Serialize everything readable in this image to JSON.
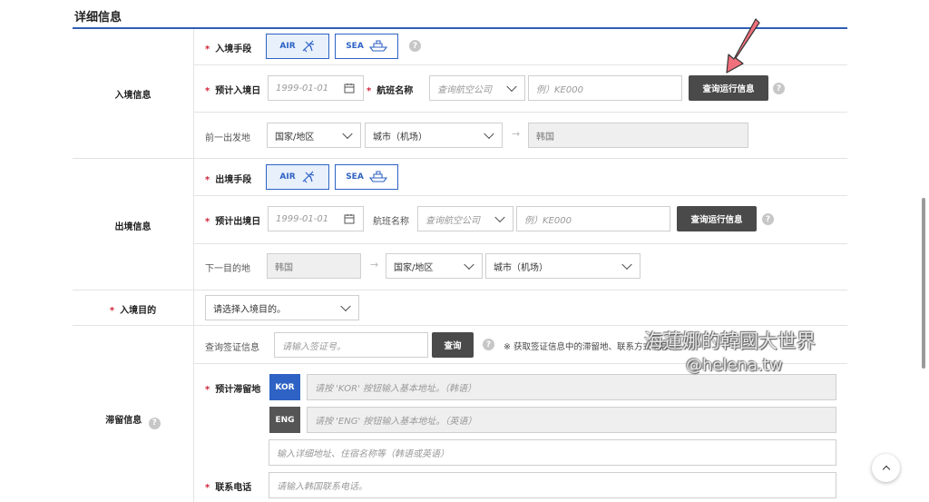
{
  "section_title": "详细信息",
  "entry": {
    "category": "入境信息",
    "mode_label": "入境手段",
    "mode_air": "AIR",
    "mode_sea": "SEA",
    "date_label": "预计入境日",
    "date_placeholder": "1999-01-01",
    "flight_label": "航班名称",
    "airline_placeholder": "查询航空公司",
    "flight_placeholder": "例）KE000",
    "search_button": "查询运行信息",
    "origin_label": "前一出发地",
    "country_select": "国家/地区",
    "city_select": "城市（机场）",
    "arrival_country": "韩国"
  },
  "exit": {
    "category": "出境信息",
    "mode_label": "出境手段",
    "mode_air": "AIR",
    "mode_sea": "SEA",
    "date_label": "预计出境日",
    "date_placeholder": "1999-01-01",
    "flight_label": "航班名称",
    "airline_placeholder": "查询航空公司",
    "flight_placeholder": "例）KE000",
    "search_button": "查询运行信息",
    "dest_label": "下一目的地",
    "departure_country": "韩国",
    "country_select": "国家/地区",
    "city_select": "城市（机场）"
  },
  "purpose": {
    "label": "入境目的",
    "select": "请选择入境目的。"
  },
  "stay": {
    "category": "滞留信息",
    "visa_label": "查询签证信息",
    "visa_placeholder": "请输入签证号。",
    "visa_button": "查询",
    "visa_note": "※ 获取签证信息中的滞留地、联系方式信息。",
    "address_label": "预计滞留地",
    "kor_button": "KOR",
    "kor_placeholder": "请按 'KOR' 按钮输入基本地址。（韩语）",
    "eng_button": "ENG",
    "eng_placeholder": "请按 'ENG' 按钮输入基本地址。（英语）",
    "detail_placeholder": "输入详细地址、住宿名称等（韩语或英语）",
    "phone_label": "联系电话",
    "phone_placeholder": "请输入韩国联系电话。"
  },
  "watermark": {
    "line1": "海蓮娜的韓國大世界",
    "line2": "@helena.tw"
  },
  "colors": {
    "accent": "#2e62c4",
    "kor_button": "#2e62c4",
    "eng_button": "#555555",
    "required_star": "#d0243a",
    "pointer_arrow": "#f0707c"
  }
}
